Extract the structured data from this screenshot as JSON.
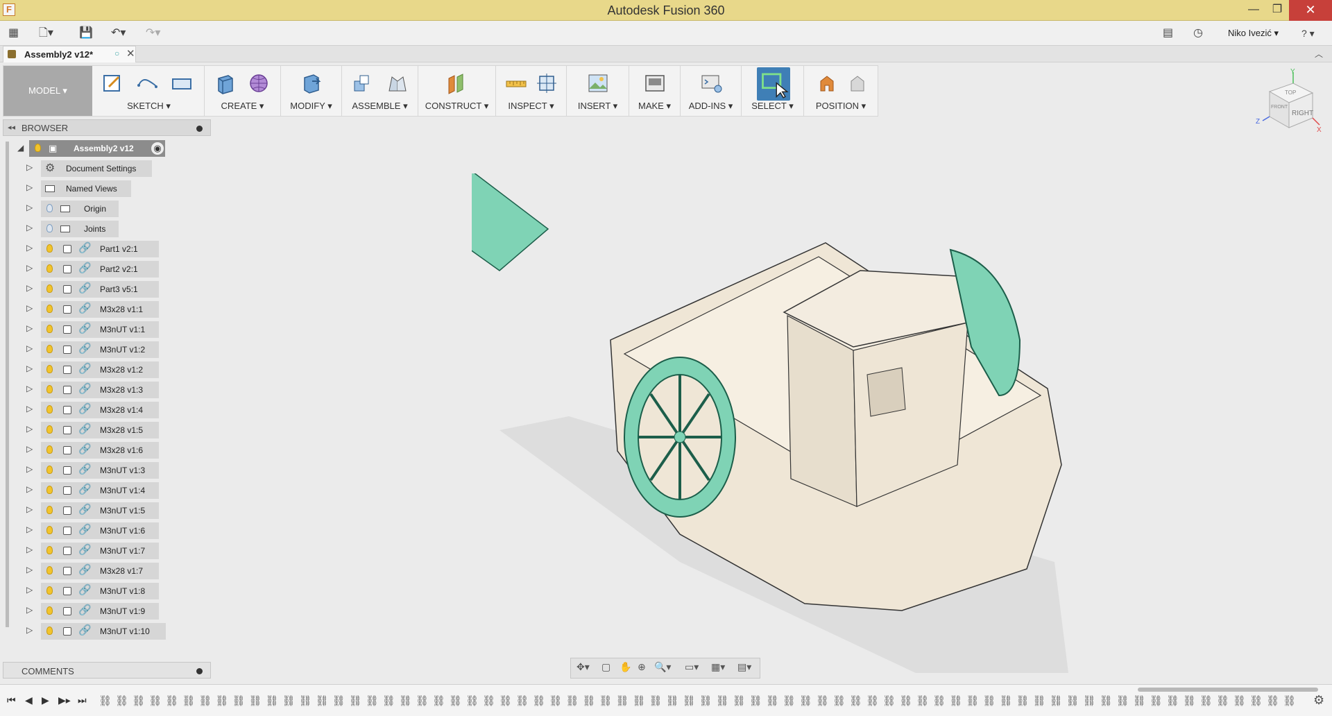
{
  "window": {
    "title": "Autodesk Fusion 360",
    "min": "—",
    "max": "❐",
    "close": "✕"
  },
  "quickbar": {
    "user": "Niko Ivezić ▾",
    "help": "? ▾"
  },
  "tab": {
    "label": "Assembly2 v12*",
    "close": "✕"
  },
  "ribbon": {
    "workspace": "MODEL ▾",
    "groups": {
      "sketch": "SKETCH ▾",
      "create": "CREATE ▾",
      "modify": "MODIFY ▾",
      "assemble": "ASSEMBLE ▾",
      "construct": "CONSTRUCT ▾",
      "inspect": "INSPECT ▾",
      "insert": "INSERT ▾",
      "make": "MAKE ▾",
      "addins": "ADD-INS ▾",
      "select": "SELECT ▾",
      "position": "POSITION ▾"
    }
  },
  "browser": {
    "title": "BROWSER",
    "root": "Assembly2 v12",
    "items": [
      {
        "label": "Document Settings",
        "kind": "settings"
      },
      {
        "label": "Named Views",
        "kind": "folder"
      },
      {
        "label": "Origin",
        "kind": "folder-bulb"
      },
      {
        "label": "Joints",
        "kind": "folder-bulb"
      },
      {
        "label": "Part1 v2:1",
        "kind": "link"
      },
      {
        "label": "Part2 v2:1",
        "kind": "link"
      },
      {
        "label": "Part3 v5:1",
        "kind": "link"
      },
      {
        "label": "M3x28 v1:1",
        "kind": "link"
      },
      {
        "label": "M3nUT v1:1",
        "kind": "link"
      },
      {
        "label": "M3nUT v1:2",
        "kind": "link"
      },
      {
        "label": "M3x28 v1:2",
        "kind": "link"
      },
      {
        "label": "M3x28 v1:3",
        "kind": "link"
      },
      {
        "label": "M3x28 v1:4",
        "kind": "link"
      },
      {
        "label": "M3x28 v1:5",
        "kind": "link"
      },
      {
        "label": "M3x28 v1:6",
        "kind": "link"
      },
      {
        "label": "M3nUT v1:3",
        "kind": "link"
      },
      {
        "label": "M3nUT v1:4",
        "kind": "link"
      },
      {
        "label": "M3nUT v1:5",
        "kind": "link"
      },
      {
        "label": "M3nUT v1:6",
        "kind": "link"
      },
      {
        "label": "M3nUT v1:7",
        "kind": "link"
      },
      {
        "label": "M3x28 v1:7",
        "kind": "link"
      },
      {
        "label": "M3nUT v1:8",
        "kind": "link"
      },
      {
        "label": "M3nUT v1:9",
        "kind": "link"
      },
      {
        "label": "M3nUT v1:10",
        "kind": "link"
      }
    ]
  },
  "comments": {
    "title": "COMMENTS"
  },
  "viewcube": {
    "face_right": "RIGHT",
    "face_top": "TOP",
    "face_front": "FRONT",
    "axis_y": "Y",
    "axis_x": "X",
    "axis_z": "Z"
  },
  "colors": {
    "title_bar": "#e8d88a",
    "accent": "#3f7fb6",
    "part_green": "#7fd3b5",
    "hull": "#efe6d6"
  }
}
